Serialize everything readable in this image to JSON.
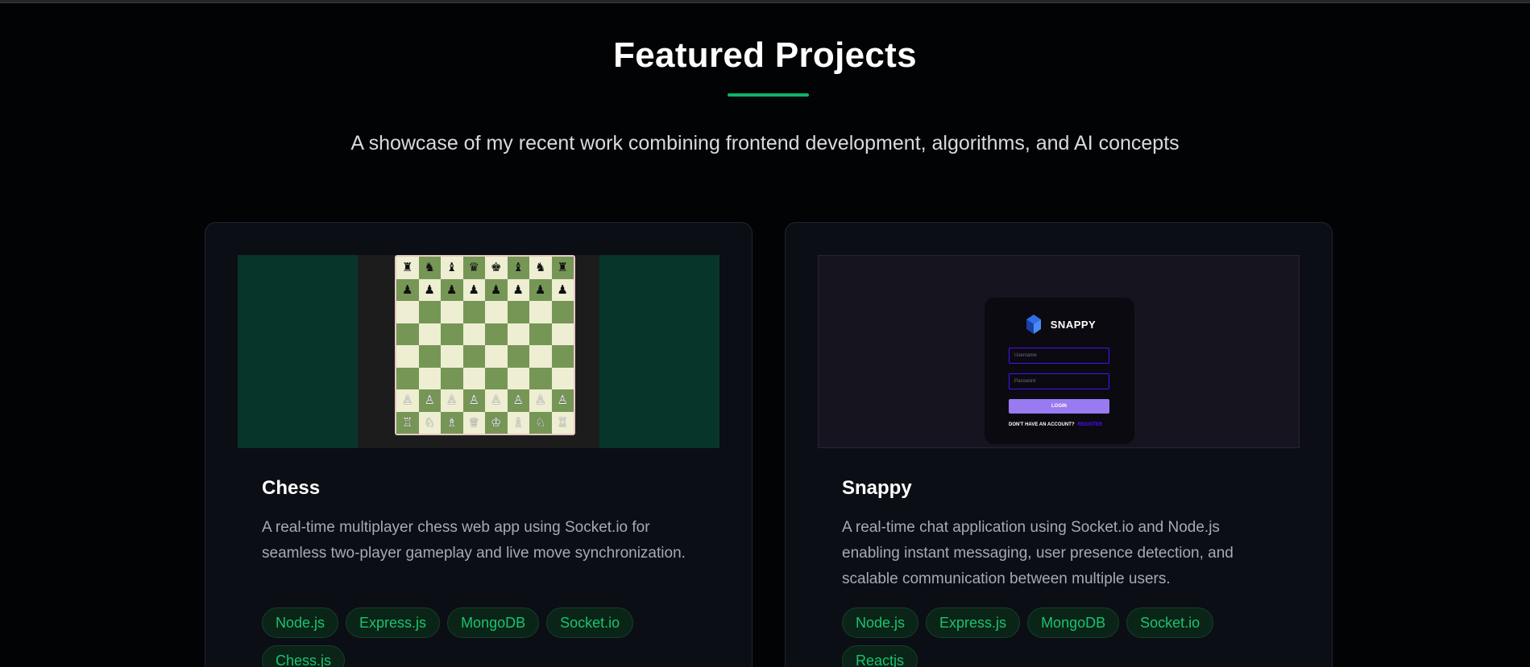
{
  "section": {
    "title": "Featured Projects",
    "subtitle": "A showcase of my recent work combining frontend development, algorithms, and AI concepts"
  },
  "colors": {
    "background": "#020304",
    "card": "#0b0e14",
    "accent": "#10b26a",
    "tag_text": "#18c46e",
    "snappy_purple": "#997af0"
  },
  "projects": [
    {
      "title": "Chess",
      "description": "A real-time multiplayer chess web app using Socket.io for seamless two-player gameplay and live move synchronization.",
      "tags": [
        "Node.js",
        "Express.js",
        "MongoDB",
        "Socket.io",
        "Chess.js"
      ],
      "preview": {
        "type": "chess-board",
        "board": [
          [
            "♜",
            "♞",
            "♝",
            "♛",
            "♚",
            "♝",
            "♞",
            "♜"
          ],
          [
            "♟",
            "♟",
            "♟",
            "♟",
            "♟",
            "♟",
            "♟",
            "♟"
          ],
          [
            "",
            "",
            "",
            "",
            "",
            "",
            "",
            ""
          ],
          [
            "",
            "",
            "",
            "",
            "",
            "",
            "",
            ""
          ],
          [
            "",
            "",
            "",
            "",
            "",
            "",
            "",
            ""
          ],
          [
            "",
            "",
            "",
            "",
            "",
            "",
            "",
            ""
          ],
          [
            "♙",
            "♙",
            "♙",
            "♙",
            "♙",
            "♙",
            "♙",
            "♙"
          ],
          [
            "♖",
            "♘",
            "♗",
            "♕",
            "♔",
            "♗",
            "♘",
            "♖"
          ]
        ]
      }
    },
    {
      "title": "Snappy",
      "description": "A real-time chat application using Socket.io and Node.js enabling instant messaging, user presence detection, and scalable communication between multiple users.",
      "tags": [
        "Node.js",
        "Express.js",
        "MongoDB",
        "Socket.io",
        "Reactjs"
      ],
      "preview": {
        "type": "login-screen",
        "brand": "SNAPPY",
        "logo_icon": "snappy-logo-icon",
        "username_placeholder": "Username",
        "password_placeholder": "Password",
        "login_label": "LOGIN",
        "footer_text": "DON'T HAVE AN ACCOUNT?",
        "register_label": "REGISTER"
      }
    }
  ]
}
